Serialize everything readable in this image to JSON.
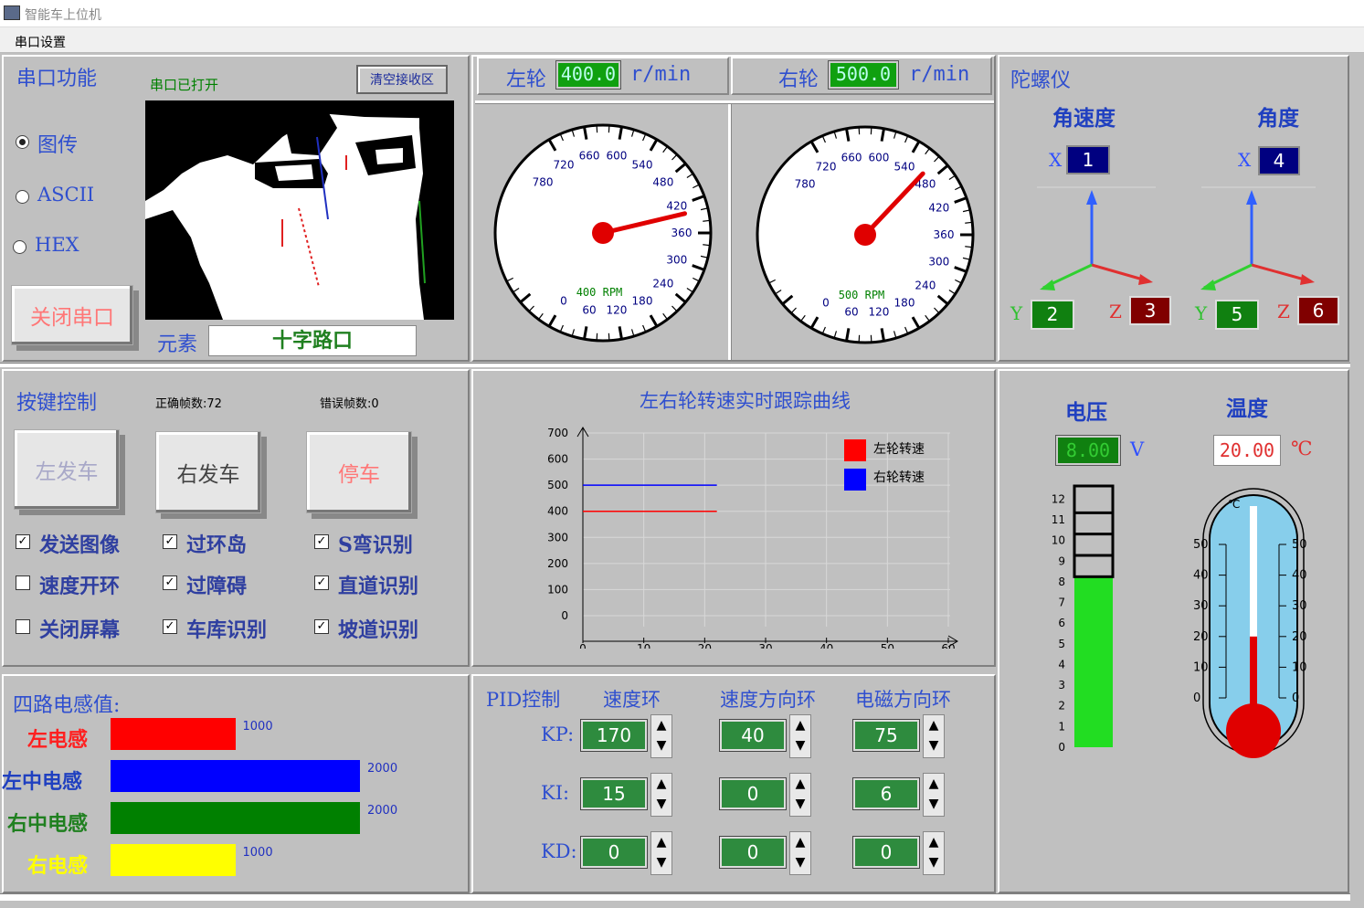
{
  "window": {
    "title": "智能车上位机",
    "menu": "串口设置"
  },
  "serial": {
    "title": "串口功能",
    "status": "串口已打开",
    "clear_label": "清空接收区",
    "options": [
      "图传",
      "ASCII",
      "HEX"
    ],
    "selected": "图传",
    "close_label": "关闭串口",
    "element_label": "元素",
    "element_value": "十字路口"
  },
  "speed": {
    "left_label": "左轮",
    "left_value": "400.0",
    "right_label": "右轮",
    "right_value": "500.0",
    "unit": "r/min"
  },
  "gauges": {
    "ticks": [
      "0",
      "60",
      "120",
      "180",
      "240",
      "300",
      "360",
      "420",
      "480",
      "540",
      "600",
      "660",
      "720",
      "780"
    ],
    "left_rpm": 400,
    "right_rpm": 500,
    "left_caption": "400 RPM",
    "right_caption": "500 RPM"
  },
  "gyro": {
    "title": "陀螺仪",
    "angvel_label": "角速度",
    "angle_label": "角度",
    "x_label": "X",
    "y_label": "Y",
    "z_label": "Z",
    "angvel": {
      "x": "1",
      "y": "2",
      "z": "3"
    },
    "angle": {
      "x": "4",
      "y": "5",
      "z": "6"
    }
  },
  "keys": {
    "title": "按键控制",
    "correct": "正确帧数:72",
    "error": "错误帧数:0",
    "btn_left": "左发车",
    "btn_right": "右发车",
    "btn_stop": "停车",
    "checks": [
      {
        "label": "发送图像",
        "checked": true
      },
      {
        "label": "过环岛",
        "checked": true
      },
      {
        "label": "S弯识别",
        "checked": true
      },
      {
        "label": "速度开环",
        "checked": false
      },
      {
        "label": "过障碍",
        "checked": true
      },
      {
        "label": "直道识别",
        "checked": true
      },
      {
        "label": "关闭屏幕",
        "checked": false
      },
      {
        "label": "车库识别",
        "checked": true
      },
      {
        "label": "坡道识别",
        "checked": true
      }
    ]
  },
  "chart_data": {
    "type": "line",
    "title": "左右轮转速实时跟踪曲线",
    "xlim": [
      0,
      60
    ],
    "ylim": [
      0,
      700
    ],
    "xticks": [
      "0",
      "10",
      "20",
      "30",
      "40",
      "50",
      "60"
    ],
    "yticks": [
      "0",
      "100",
      "200",
      "300",
      "400",
      "500",
      "600",
      "700"
    ],
    "legend_position": "top-right",
    "series": [
      {
        "name": "左轮转速",
        "color": "#ff0000",
        "x": [
          0,
          22
        ],
        "y": [
          400,
          400
        ]
      },
      {
        "name": "右轮转速",
        "color": "#0000ff",
        "x": [
          0,
          22
        ],
        "y": [
          500,
          500
        ]
      }
    ]
  },
  "voltage": {
    "title": "电压",
    "value": "8.00",
    "unit": "V",
    "level": 8,
    "max": 12,
    "ticks": [
      "0",
      "1",
      "2",
      "3",
      "4",
      "5",
      "6",
      "7",
      "8",
      "9",
      "10",
      "11",
      "12"
    ]
  },
  "temperature": {
    "title": "温度",
    "value": "20.00",
    "unit": "℃",
    "scale_unit": "℃",
    "ticks": [
      "0",
      "10",
      "20",
      "30",
      "40",
      "50"
    ]
  },
  "inductors": {
    "title": "四路电感值:",
    "items": [
      {
        "label": "左电感",
        "value": 1000,
        "color": "#ff0000",
        "value_text": "1000"
      },
      {
        "label": "左中电感",
        "value": 2000,
        "color": "#0000ff",
        "value_text": "2000"
      },
      {
        "label": "右中电感",
        "value": 2000,
        "color": "#008000",
        "value_text": "2000"
      },
      {
        "label": "右电感",
        "value": 1000,
        "color": "#ffff00",
        "value_text": "1000"
      }
    ]
  },
  "pid": {
    "title": "PID控制",
    "col1": "速度环",
    "col2": "速度方向环",
    "col3": "电磁方向环",
    "rows": [
      "KP:",
      "KI:",
      "KD:"
    ],
    "values": [
      [
        "170",
        "40",
        "75"
      ],
      [
        "15",
        "0",
        "6"
      ],
      [
        "0",
        "0",
        "0"
      ]
    ]
  }
}
